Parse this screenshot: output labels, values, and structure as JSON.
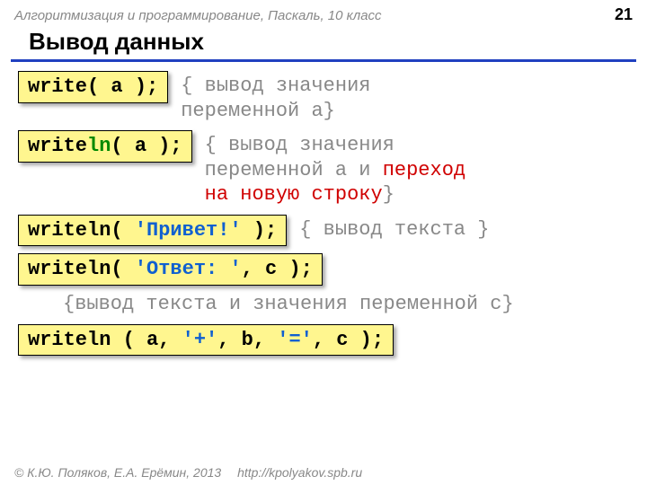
{
  "header": {
    "course": "Алгоритмизация и программирование, Паскаль, 10 класс",
    "page": "21"
  },
  "title": "Вывод данных",
  "row1": {
    "code": "write( a );",
    "comment_l1": "{ вывод значения",
    "comment_l2": "переменной a}"
  },
  "row2": {
    "code_pre": "write",
    "code_ln": "ln",
    "code_post": "( a );",
    "comment_l1": "{ вывод значения",
    "comment_l2a": "переменной a и ",
    "comment_l2b_red": "переход",
    "comment_l3_red": "на новую строку",
    "comment_l3_end": "}"
  },
  "row3": {
    "code_pre": "writeln( ",
    "code_lit": "'Привет!'",
    "code_post": " );",
    "comment": "{ вывод текста }"
  },
  "row4": {
    "code_pre": "writeln( ",
    "code_lit": "'Ответ: '",
    "code_post": ", c );"
  },
  "comment4": "{вывод текста и значения переменной c}",
  "row5": {
    "p1": "writeln ( a, ",
    "lit1": "'+'",
    "p2": ", b, ",
    "lit2": "'='",
    "p3": ", c );"
  },
  "footer": {
    "copyright": "© К.Ю. Поляков, Е.А. Ерёмин, 2013",
    "url": "http://kpolyakov.spb.ru"
  }
}
